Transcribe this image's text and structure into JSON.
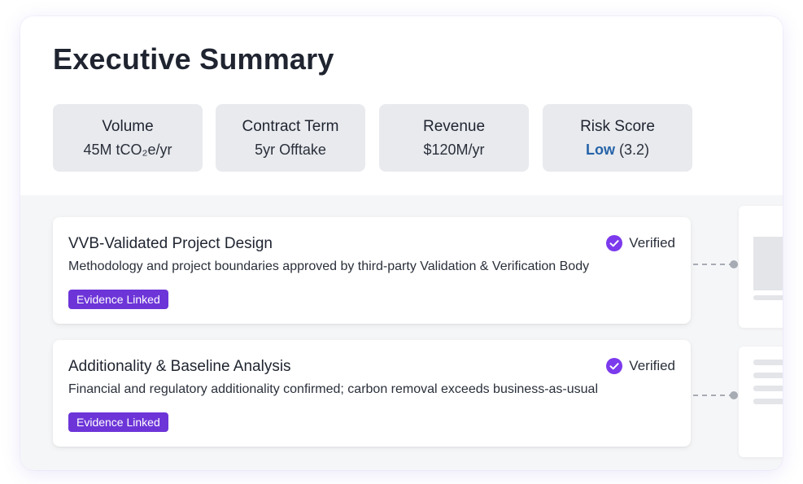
{
  "summary": {
    "title": "Executive Summary",
    "metrics": [
      {
        "label": "Volume",
        "value": "45M tCO₂e/yr"
      },
      {
        "label": "Contract Term",
        "value": "5yr Offtake"
      },
      {
        "label": "Revenue",
        "value": "$120M/yr"
      },
      {
        "label": "Risk Score",
        "value_level": "Low",
        "value_score": "(3.2)",
        "level_color": "#2563a8"
      }
    ]
  },
  "evidence": [
    {
      "title": "VVB-Validated Project Design",
      "status": "Verified",
      "description": "Methodology and project boundaries approved by third-party Validation & Verification Body",
      "badge": "Evidence Linked"
    },
    {
      "title": "Additionality & Baseline Analysis",
      "status": "Verified",
      "description": "Financial and regulatory additionality confirmed; carbon removal exceeds business-as-usual",
      "badge": "Evidence Linked"
    }
  ],
  "icons": {
    "status": "check-circle-icon",
    "doc_1": "document-icon",
    "doc_2": "text-lines-icon"
  },
  "colors": {
    "accent": "#7c3aed",
    "badge": "#6d35d8",
    "risk_low": "#2563a8"
  }
}
